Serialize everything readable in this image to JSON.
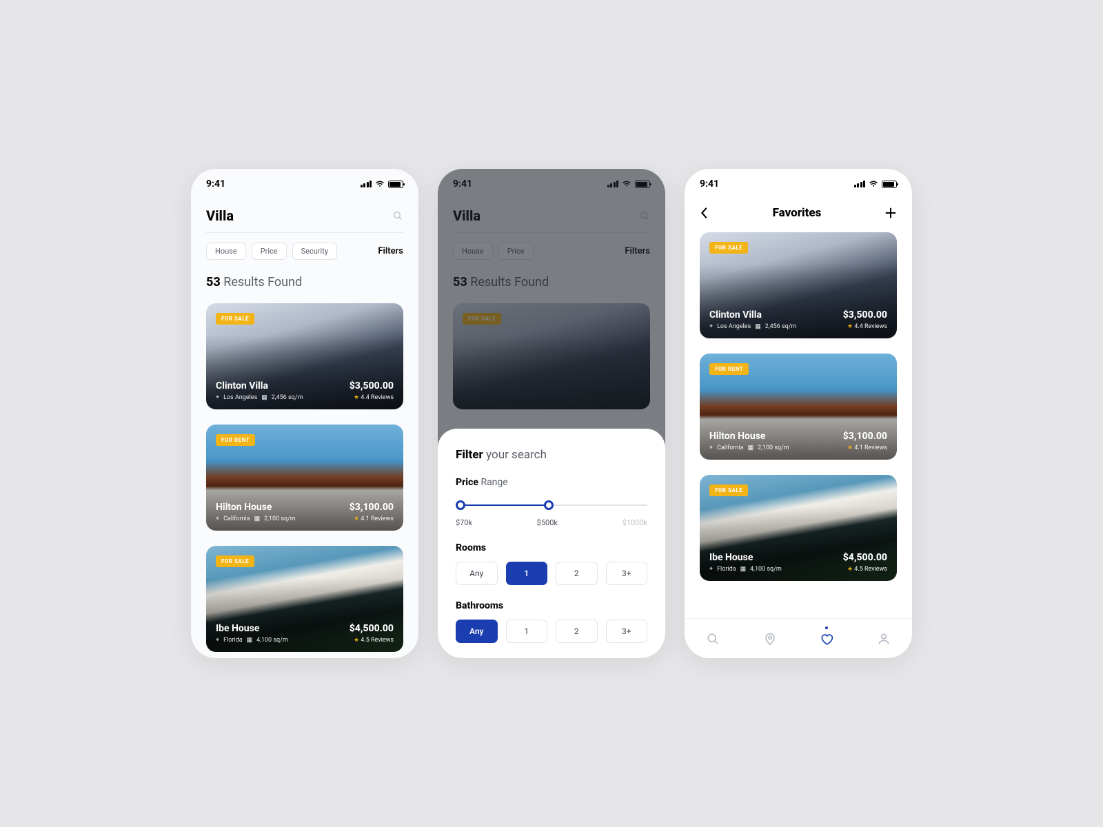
{
  "status": {
    "time": "9:41"
  },
  "screen1": {
    "search_title": "Villa",
    "chips": [
      "House",
      "Price",
      "Security"
    ],
    "filters_label": "Filters",
    "results_count": "53",
    "results_text": "Results Found"
  },
  "screen2": {
    "search_title": "Villa",
    "chips": [
      "House",
      "Price"
    ],
    "filters_label": "Filters",
    "results_count": "53",
    "results_text": "Results Found",
    "sheet": {
      "title_bold": "Filter",
      "title_rest": "your search",
      "price_bold": "Price",
      "price_rest": "Range",
      "price_min": "$70k",
      "price_mid": "$500k",
      "price_max": "$1000k",
      "rooms_label": "Rooms",
      "rooms_opts": [
        "Any",
        "1",
        "2",
        "3+"
      ],
      "rooms_active": 1,
      "bath_label": "Bathrooms",
      "bath_opts": [
        "Any",
        "1",
        "2",
        "3+"
      ],
      "bath_active": 0
    }
  },
  "screen3": {
    "title": "Favorites",
    "tab_active": 2
  },
  "listings": [
    {
      "tag": "FOR SALE",
      "name": "Clinton Villa",
      "loc": "Los Angeles",
      "area": "2,456 sq/m",
      "price": "$3,500.00",
      "rating": "4.4 Reviews",
      "variant": "modern"
    },
    {
      "tag": "FOR RENT",
      "name": "Hilton House",
      "loc": "California",
      "area": "2,100 sq/m",
      "price": "$3,100.00",
      "rating": "4.1 Reviews",
      "variant": "tudor"
    },
    {
      "tag": "FOR SALE",
      "name": "Ibe House",
      "loc": "Florida",
      "area": "4,100 sq/m",
      "price": "$4,500.00",
      "rating": "4.5 Reviews",
      "variant": "flat"
    }
  ]
}
